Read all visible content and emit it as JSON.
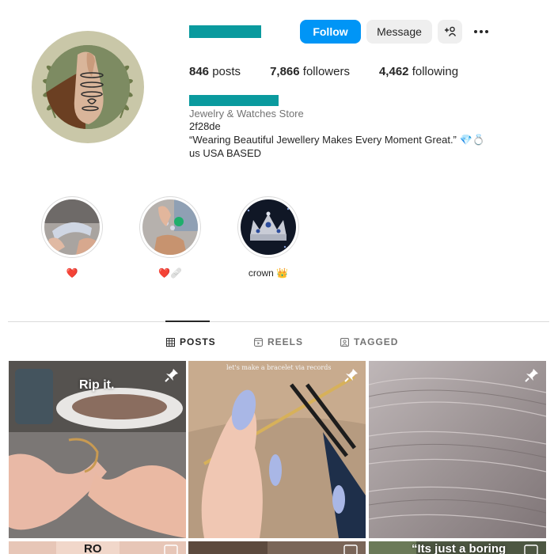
{
  "profile": {
    "follow_label": "Follow",
    "message_label": "Message",
    "stats": {
      "posts_count": "846",
      "posts_label": "posts",
      "followers_count": "7,866",
      "followers_label": "followers",
      "following_count": "4,462",
      "following_label": "following"
    },
    "category": "Jewelry & Watches Store",
    "bio_line1": "2f28de",
    "bio_line2": "“Wearing Beautiful Jewellery Makes Every Moment Great.” 💎💍",
    "bio_line3": "us USA BASED",
    "accent_color": "#0a9a9e",
    "button_color": "#0095f6"
  },
  "highlights": [
    {
      "label": "❤️"
    },
    {
      "label": "❤️🩹"
    },
    {
      "label": "crown 👑"
    }
  ],
  "tabs": {
    "posts": "POSTS",
    "reels": "REELS",
    "tagged": "TAGGED",
    "active": "posts"
  },
  "posts": [
    {
      "caption": "Rip it.",
      "pinned": true
    },
    {
      "caption": "let's make a bracelet via records",
      "pinned": true
    },
    {
      "caption": "",
      "pinned": true
    }
  ],
  "posts_row2": [
    {
      "caption": "RO"
    },
    {
      "caption": ""
    },
    {
      "caption": "“Its just a boring"
    }
  ]
}
